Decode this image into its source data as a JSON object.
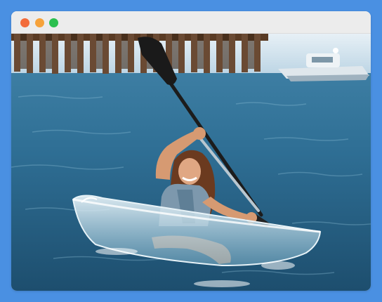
{
  "window": {
    "controls": [
      {
        "name": "close",
        "color": "#f26b3a"
      },
      {
        "name": "minimize",
        "color": "#f6a23a"
      },
      {
        "name": "maximize",
        "color": "#2bbf4f"
      }
    ]
  },
  "photo": {
    "subject": "woman-paddling-clear-kayak",
    "colors": {
      "sky": "#cfe3ef",
      "water": "#2f6f95",
      "pier": "#6a4a33",
      "kayak": "#dcecf2",
      "paddle": "#1f1f1f"
    }
  }
}
